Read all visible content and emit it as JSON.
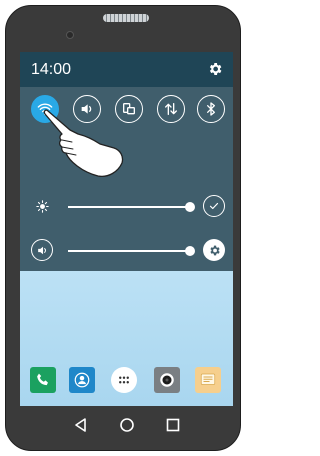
{
  "status_bar": {
    "time": "14:00",
    "settings_icon": "gear-icon"
  },
  "quick_settings": {
    "toggles": [
      {
        "name": "wifi",
        "icon": "wifi-icon",
        "active": true
      },
      {
        "name": "sound",
        "icon": "volume-icon",
        "active": false
      },
      {
        "name": "screen-rotate",
        "icon": "rotate-icon",
        "active": false
      },
      {
        "name": "data-sync",
        "icon": "sync-arrows-icon",
        "active": false
      },
      {
        "name": "bluetooth",
        "icon": "bluetooth-icon",
        "active": false
      }
    ],
    "brightness": {
      "icon": "brightness-icon",
      "level": 1.0,
      "auto_icon": "check-icon"
    },
    "volume": {
      "icon": "volume-icon",
      "level": 1.0,
      "settings_icon": "gear-icon"
    }
  },
  "dock": {
    "apps": [
      {
        "name": "phone",
        "icon": "phone-icon",
        "color": "#1ba160"
      },
      {
        "name": "contacts",
        "icon": "contact-icon",
        "color": "#1f87c9"
      },
      {
        "name": "app-drawer",
        "icon": "apps-grid-icon",
        "color": "#ffffff"
      },
      {
        "name": "camera",
        "icon": "camera-icon",
        "color": "#7a7f83"
      },
      {
        "name": "messages",
        "icon": "message-icon",
        "color": "#f6cf8d"
      }
    ]
  },
  "nav_bar": {
    "back": "back-icon",
    "home": "home-icon",
    "recents": "recents-icon"
  },
  "colors": {
    "accent": "#29a9e6",
    "panel": "#405e6c",
    "status_bar": "#1f4556",
    "phone_body": "#3a3a3a"
  }
}
